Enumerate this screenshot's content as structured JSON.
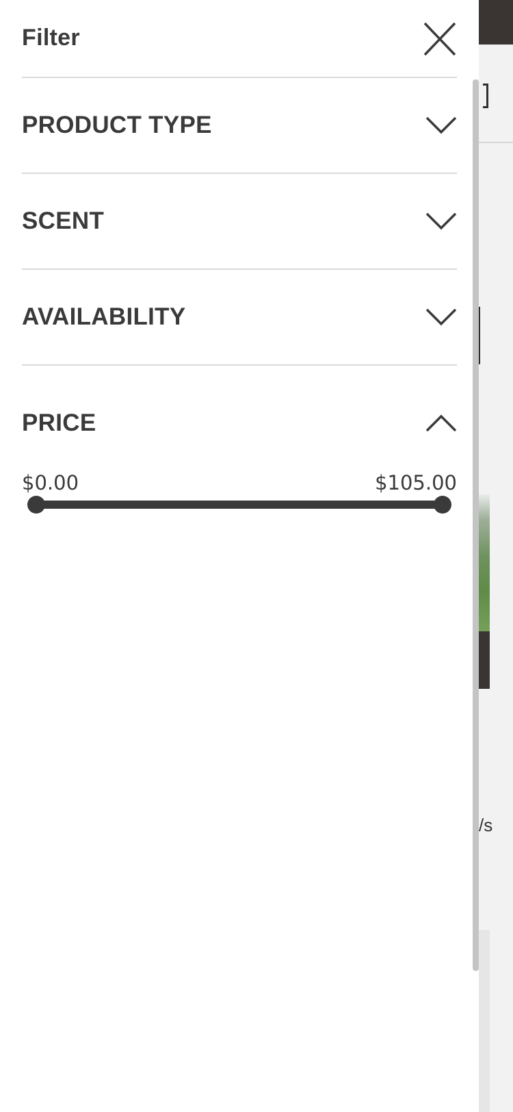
{
  "filter": {
    "title": "Filter",
    "close_icon": "close-icon",
    "sections": [
      {
        "label": "PRODUCT TYPE",
        "icon": "chevron-down-icon",
        "expanded": false
      },
      {
        "label": "SCENT",
        "icon": "chevron-down-icon",
        "expanded": false
      },
      {
        "label": "AVAILABILITY",
        "icon": "chevron-down-icon",
        "expanded": false
      },
      {
        "label": "PRICE",
        "icon": "chevron-up-icon",
        "expanded": true
      }
    ],
    "price": {
      "min_label": "$0.00",
      "max_label": "$105.00",
      "selected_min": 0,
      "selected_max": 105
    }
  },
  "background": {
    "partial_text": "/s"
  },
  "colors": {
    "text": "#3a3a3a",
    "divider": "#d9d9d9",
    "slider": "#3a3a3a",
    "topbar": "#3a3533"
  }
}
